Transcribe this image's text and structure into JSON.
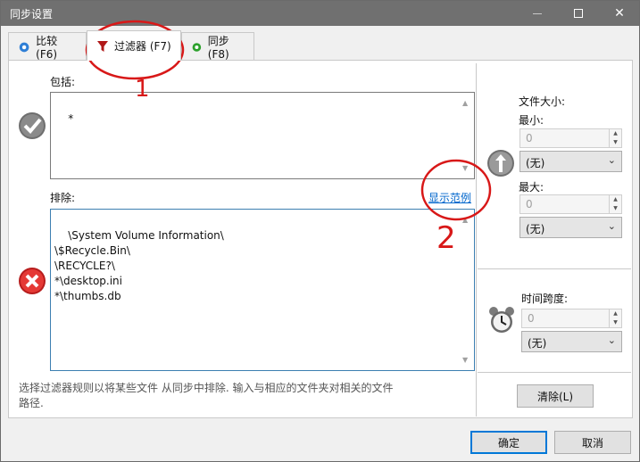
{
  "window": {
    "title": "同步设置"
  },
  "tabs": [
    {
      "label": "比较 (F6)",
      "icon": "gear-icon"
    },
    {
      "label": "过滤器 (F7)",
      "icon": "funnel-icon"
    },
    {
      "label": "同步 (F8)",
      "icon": "green-gear-icon"
    }
  ],
  "filter": {
    "include_label": "包括:",
    "include_value": "*",
    "exclude_label": "排除:",
    "exclude_value": "\\System Volume Information\\\n\\$Recycle.Bin\\\n\\RECYCLE?\\\n*\\desktop.ini\n*\\thumbs.db",
    "show_examples": "显示范例",
    "hint": "选择过滤器规则以将某些文件 从同步中排除. 输入与相应的文件夹对相关的文件路径."
  },
  "size": {
    "title": "文件大小:",
    "min_label": "最小:",
    "min_value": "0",
    "min_unit": "(无)",
    "max_label": "最大:",
    "max_value": "0",
    "max_unit": "(无)"
  },
  "time": {
    "label": "时间跨度:",
    "value": "0",
    "unit": "(无)"
  },
  "buttons": {
    "clear": "清除(L)",
    "ok": "确定",
    "cancel": "取消"
  },
  "annotations": [
    "1",
    "2"
  ]
}
